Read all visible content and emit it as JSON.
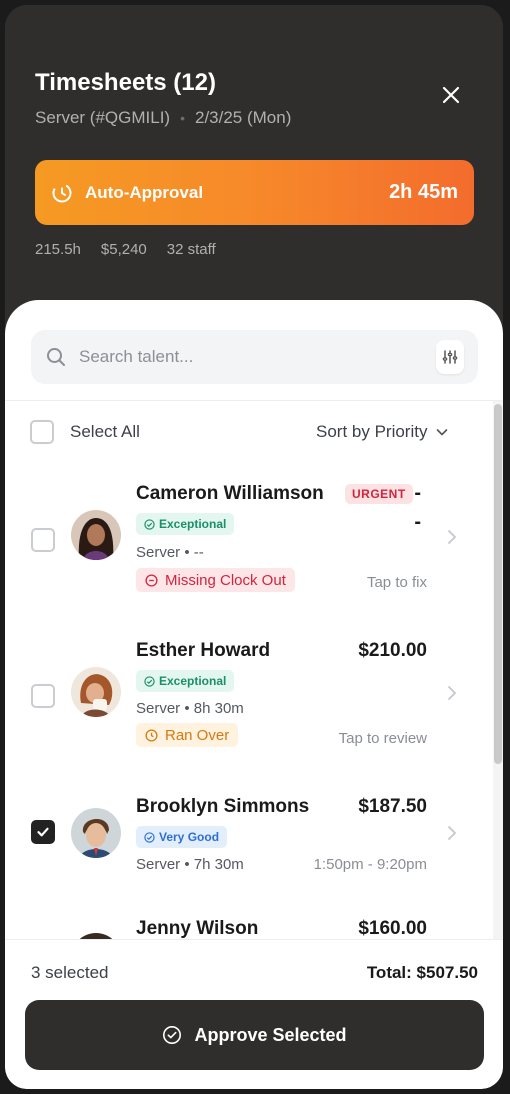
{
  "header": {
    "title": "Timesheets (12)",
    "role": "Server (#QGMILI)",
    "date": "2/3/25 (Mon)",
    "close_icon": "close-icon"
  },
  "auto_approval": {
    "label": "Auto-Approval",
    "time_remaining": "2h 45m",
    "icon": "timer-icon",
    "colors": [
      "#f59a23",
      "#f36c2d"
    ]
  },
  "stats": {
    "hours": "215.5h",
    "cost": "$5,240",
    "staff": "32 staff"
  },
  "search": {
    "placeholder": "Search talent...",
    "value": ""
  },
  "list_controls": {
    "select_all_label": "Select All",
    "select_all_checked": false,
    "sort_label": "Sort by Priority"
  },
  "rows": [
    {
      "name": "Cameron Williamson",
      "tag": "URGENT",
      "amount": "-\n-",
      "rating": "Exceptional",
      "meta": "Server • --",
      "status": "Missing Clock Out",
      "hint": "Tap to fix",
      "checked": false
    },
    {
      "name": "Esther Howard",
      "amount": "$210.00",
      "rating": "Exceptional",
      "meta": "Server • 8h 30m",
      "status": "Ran Over",
      "hint": "Tap to review",
      "checked": false
    },
    {
      "name": "Brooklyn Simmons",
      "amount": "$187.50",
      "rating": "Very Good",
      "meta": "Server • 7h 30m",
      "hint": "1:50pm - 9:20pm",
      "checked": true
    },
    {
      "name": "Jenny Wilson",
      "amount": "$160.00",
      "checked": false
    }
  ],
  "footer": {
    "selected_count": "3 selected",
    "total": "Total: $507.50",
    "approve_label": "Approve Selected"
  }
}
